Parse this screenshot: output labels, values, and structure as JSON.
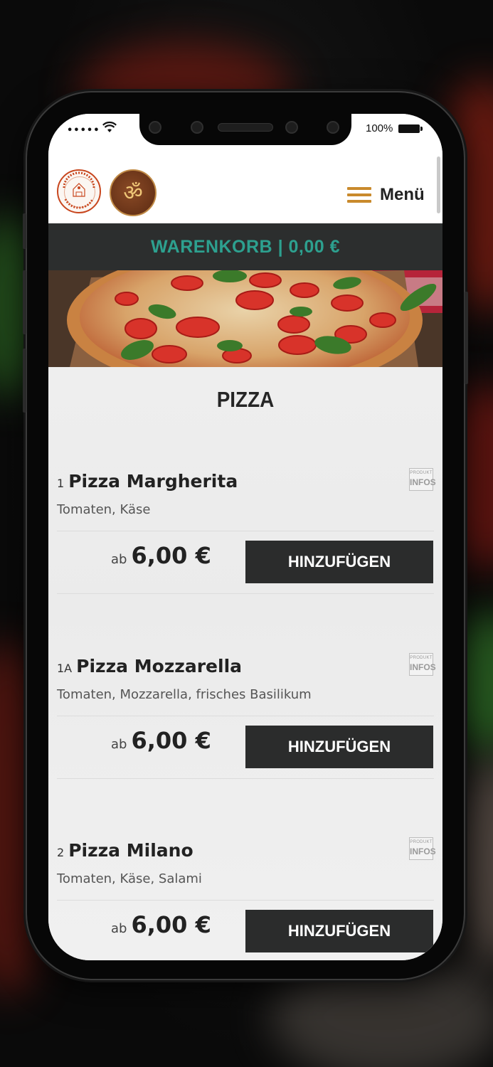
{
  "status_bar": {
    "signal": "•••••",
    "battery_text": "100%"
  },
  "header": {
    "menu_label": "Menü",
    "logo_primary_icon": "super-pizza-service-logo",
    "logo_secondary_icon": "om-restaurant-logo"
  },
  "cart": {
    "label": "WARENKORB",
    "separator": "|",
    "total": "0,00 €"
  },
  "hero_image": "pizza-photo",
  "section": {
    "title": "PIZZA"
  },
  "info_icon": {
    "top_text": "PRODUKT",
    "bottom_text": "INFOS"
  },
  "items": [
    {
      "number": "1",
      "name": "Pizza Margherita",
      "description": "Tomaten, Käse",
      "price_prefix": "ab",
      "price": "6,00 €",
      "button_label": "HINZUFÜGEN"
    },
    {
      "number": "1A",
      "name": "Pizza Mozzarella",
      "description": "Tomaten, Mozzarella, frisches Basilikum",
      "price_prefix": "ab",
      "price": "6,00 €",
      "button_label": "HINZUFÜGEN"
    },
    {
      "number": "2",
      "name": "Pizza Milano",
      "description": "Tomaten, Käse, Salami",
      "price_prefix": "ab",
      "price": "6,00 €",
      "button_label": "HINZUFÜGEN"
    }
  ],
  "colors": {
    "accent_teal": "#2da08f",
    "cart_bar_bg": "#2c2e2e",
    "button_bg": "#2b2c2c",
    "menu_icon": "#c98a2c"
  }
}
